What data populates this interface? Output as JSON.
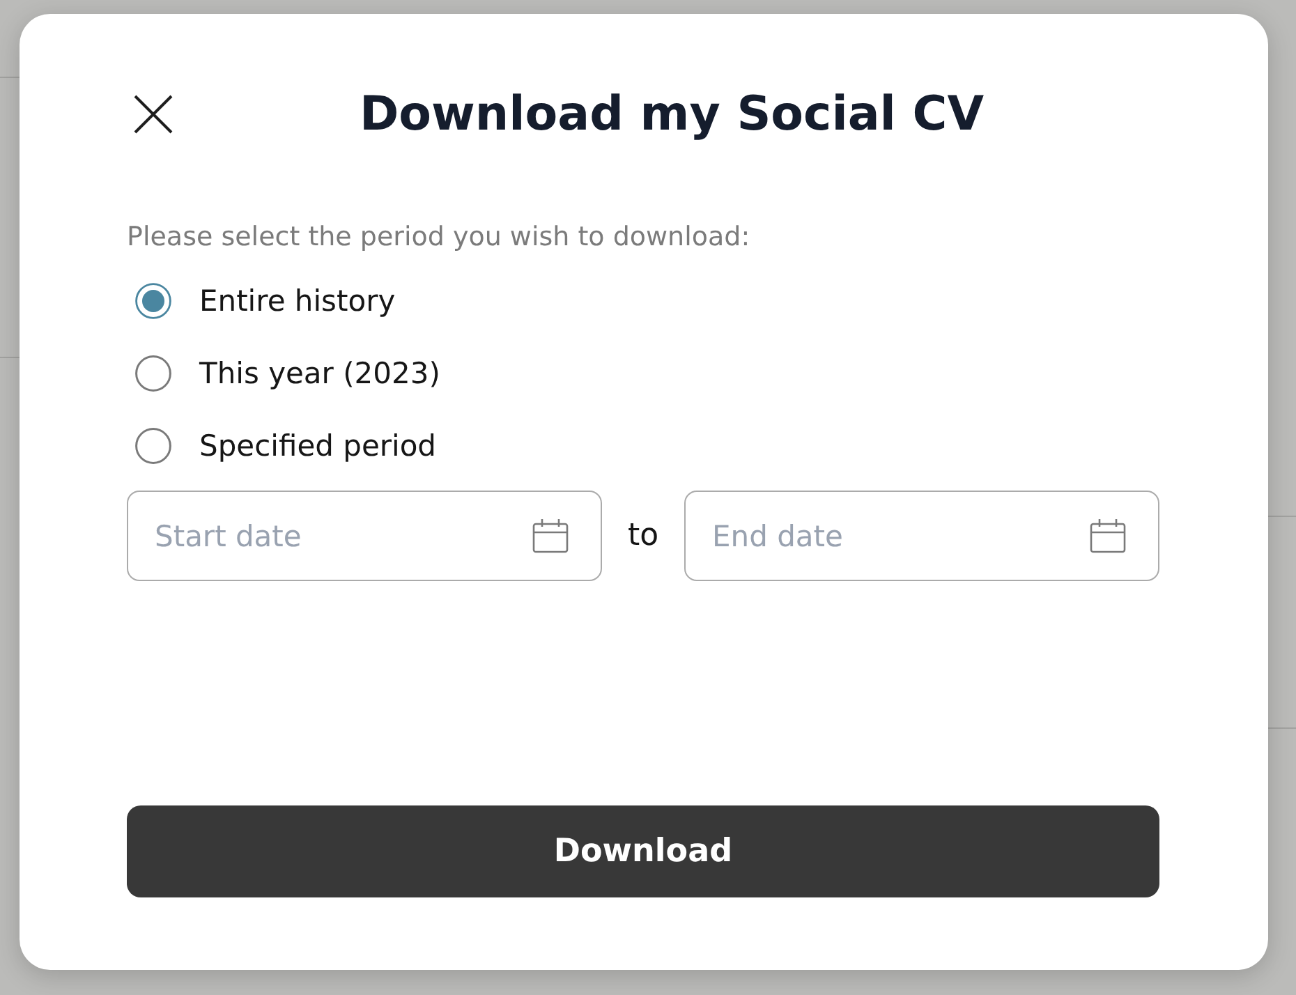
{
  "dialog": {
    "title": "Download my Social CV",
    "prompt": "Please select the period you wish to download:",
    "options": [
      {
        "label": "Entire history",
        "selected": true
      },
      {
        "label": "This year (2023)",
        "selected": false
      },
      {
        "label": "Specified period",
        "selected": false
      }
    ],
    "date_range": {
      "start": {
        "placeholder": "Start date"
      },
      "separator": "to",
      "end": {
        "placeholder": "End date"
      }
    },
    "button": {
      "label": "Download"
    }
  }
}
